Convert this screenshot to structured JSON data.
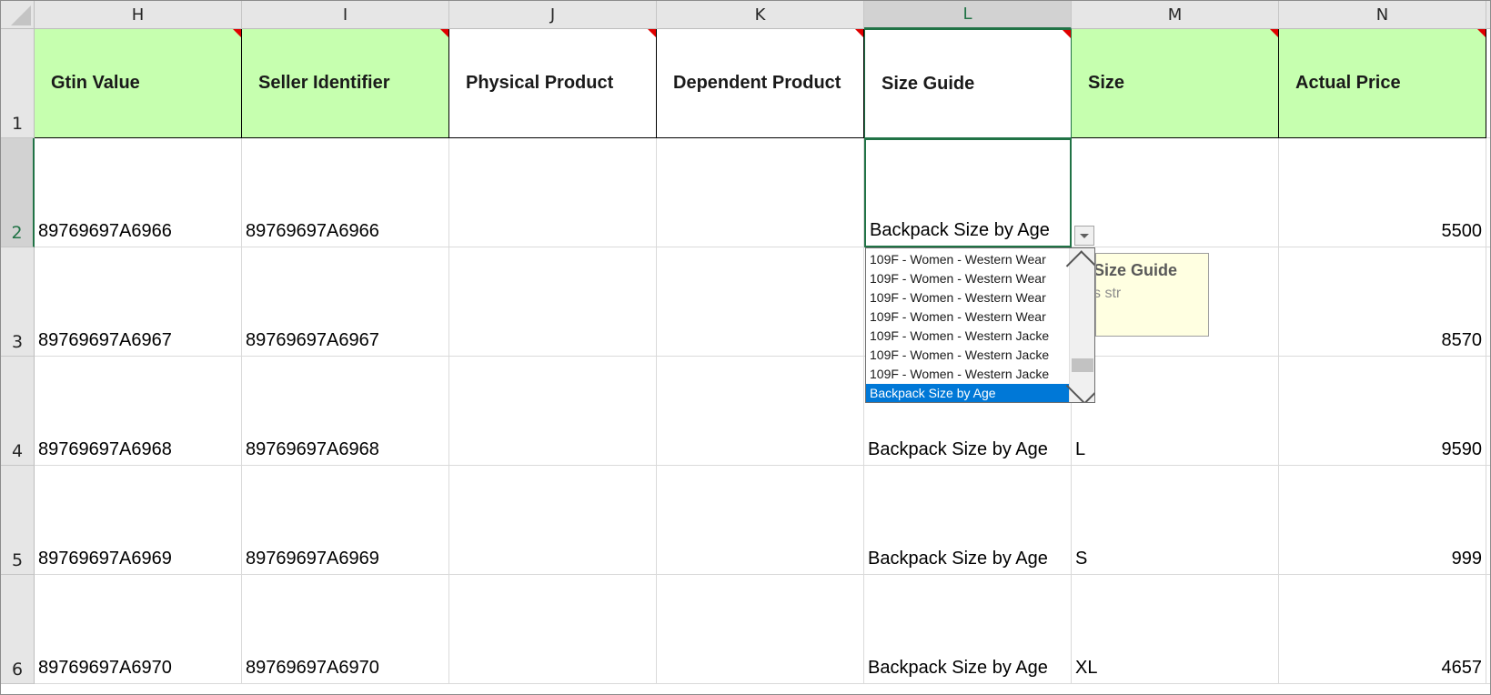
{
  "sheet": {
    "columns": [
      "H",
      "I",
      "J",
      "K",
      "L",
      "M",
      "N"
    ],
    "rows": [
      "1",
      "2",
      "3",
      "4",
      "5",
      "6"
    ],
    "headers": {
      "h": "Gtin Value",
      "i": "Seller Identifier",
      "j": "Physical Product",
      "k": "Dependent Product",
      "l": "Size Guide",
      "m": "Size",
      "n": "Actual Price"
    },
    "data": {
      "r2": {
        "h": "89769697A6966",
        "i": "89769697A6966",
        "l": "Backpack Size by Age",
        "m": "",
        "n": "5500"
      },
      "r3": {
        "h": "89769697A6967",
        "i": "89769697A6967",
        "l": "",
        "m": "",
        "n": "8570"
      },
      "r4": {
        "h": "89769697A6968",
        "i": "89769697A6968",
        "l": "Backpack Size by Age",
        "m": "L",
        "n": "9590"
      },
      "r5": {
        "h": "89769697A6969",
        "i": "89769697A6969",
        "l": "Backpack Size by Age",
        "m": "S",
        "n": "999"
      },
      "r6": {
        "h": "89769697A6970",
        "i": "89769697A6970",
        "l": "Backpack Size by Age",
        "m": "XL",
        "n": "4657"
      }
    }
  },
  "dropdown": {
    "options": [
      "109F - Women - Western Wear",
      "109F - Women - Western Wear",
      "109F - Women - Western Wear",
      "109F - Women - Western Wear",
      "109F - Women - Western Jacke",
      "109F - Women - Western Jacke",
      "109F - Women - Western Jacke",
      "Backpack Size by Age"
    ],
    "selected_index": 7
  },
  "tooltip": {
    "title": "Size Guide",
    "body": "s str"
  },
  "colors": {
    "header_green": "#c6ffaf",
    "selection_green": "#217346",
    "note_red": "#e00000",
    "dropdown_highlight": "#0078d7",
    "tooltip_bg": "#ffffe1"
  }
}
